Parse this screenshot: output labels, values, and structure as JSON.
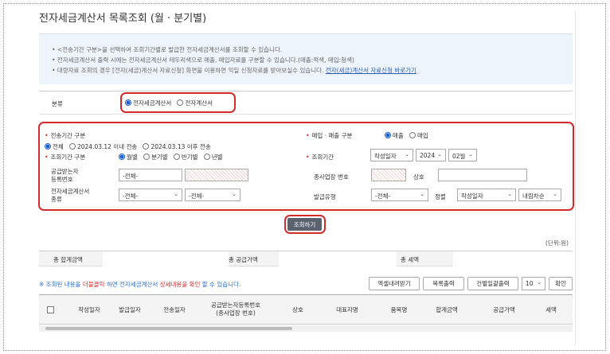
{
  "page_title": "전자세금계산서 목록조회 (월 · 분기별)",
  "info": {
    "line1": "• <전송기간 구분>을 선택하여 조회기간별로 발급한 전자세금계산서를 조회할 수 있습니다.",
    "line2": "• 전자세금계산서 출력 시에는 전자세금계산서 테두리색으로 매출, 매입자료를 구분할 수 있습니다.(매출:적색, 매입:청색)",
    "line3_prefix": "• 대량자료 조회의 경우 [전자(세금)계산서 자료신청] 화면을 이용하면 익일 신청자료를 받아보실수 있습니다.",
    "line3_link": "전자(세금)계산서 자료신청 바로가기"
  },
  "category": {
    "label": "분류",
    "opt1": "전자세금계산서",
    "opt2": "전자계산서",
    "selected": "전자세금계산서"
  },
  "filters": {
    "transmit_label": "전송기간 구분",
    "transmit_opt1": "전체",
    "transmit_opt2": "2024.03.12 이내 전송",
    "transmit_opt3": "2024.03.13 이후 전송",
    "sales_label": "매입 · 매출 구분",
    "sales_opt1": "매출",
    "sales_opt2": "매입",
    "period_type_label": "조회기간 구분",
    "period_opt1": "월별",
    "period_opt2": "분기별",
    "period_opt3": "반기별",
    "period_opt4": "년별",
    "period_label": "조회기간",
    "period_type_value": "작성일자",
    "year_value": "2024",
    "month_value": "02월",
    "buyer_reg_label_1": "공급받는자",
    "buyer_reg_label_2": "등록번호",
    "buyer_reg_select": "-전체-",
    "branch_label": "종사업장 번호",
    "company_label": "상호",
    "invoice_type_label_1": "전자세금계산서",
    "invoice_type_label_2": "종류",
    "invoice_type_1": "-전체-",
    "invoice_type_2": "-전체-",
    "issue_type_label": "발급유형",
    "issue_type_value": "-전체-",
    "sort_label": "정렬",
    "sort_value": "작성일자",
    "order_value": "내림차순"
  },
  "search_button": "조회하기",
  "unit_text": "(단위:원)",
  "summary": {
    "total_label": "총 합계금액",
    "supply_label": "총 공급가액",
    "tax_label": "총 세액"
  },
  "notice": {
    "prefix": "※ 조회된 내용을 ",
    "dblclick": "더블클릭",
    "mid": " 하면 전자세금계산서 ",
    "detail": "상세내용을 확인",
    "suffix": " 할 수 있습니다."
  },
  "toolbar": {
    "excel": "엑셀내려받기",
    "print_list": "목록출력",
    "bulk_print": "건별일괄출력",
    "page_size": "10",
    "confirm": "확인"
  },
  "columns": [
    "작성일자",
    "발급일자",
    "전송일자",
    "공급받는자등록번호",
    "(종사업장 번호)",
    "상호",
    "대표자명",
    "품목명",
    "합계금액",
    "공급가액",
    "세액"
  ],
  "colors": {
    "accent_red": "#d12b2b",
    "radio_blue": "#1a5fd1",
    "link_blue": "#2a5bb5",
    "info_bg": "#eef4fb"
  }
}
